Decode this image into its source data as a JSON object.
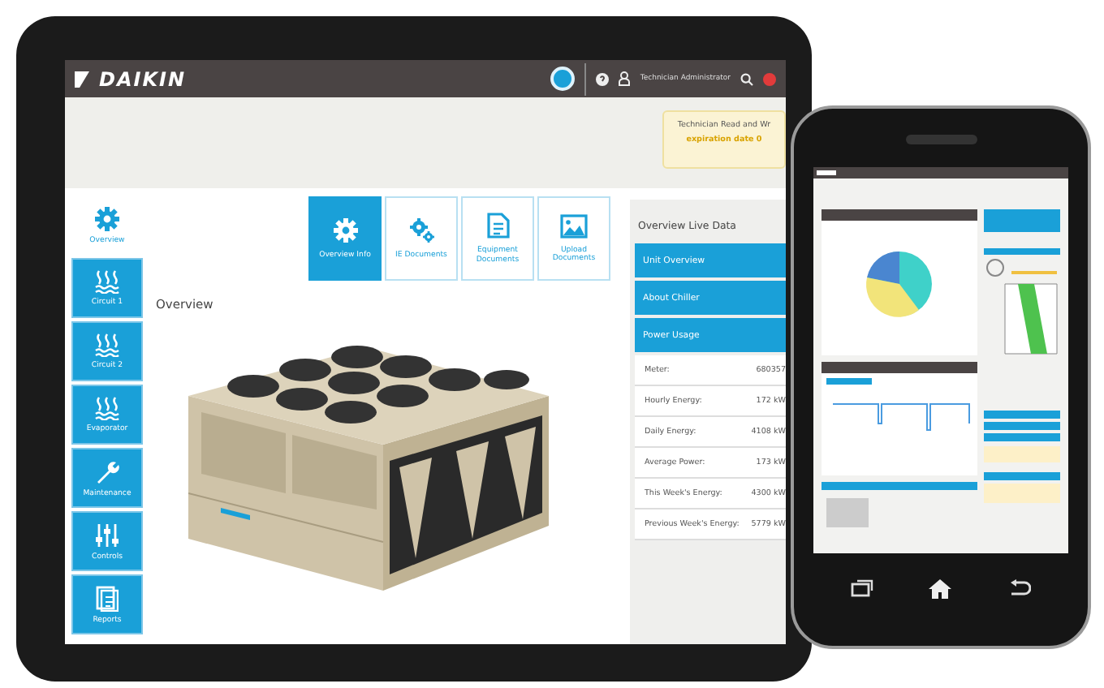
{
  "header": {
    "logo": "DAIKIN",
    "user": "Technician Administrator"
  },
  "banner": {
    "line1": "Technician Read and Wr",
    "line2": "expiration date 0"
  },
  "sidebar": {
    "items": [
      {
        "label": "Overview",
        "kind": "gear",
        "selected": true
      },
      {
        "label": "Circuit 1",
        "kind": "heat",
        "selected": false
      },
      {
        "label": "Circuit 2",
        "kind": "heat",
        "selected": false
      },
      {
        "label": "Evaporator",
        "kind": "heat",
        "selected": false
      },
      {
        "label": "Maintenance",
        "kind": "wrench",
        "selected": false
      },
      {
        "label": "Controls",
        "kind": "sliders",
        "selected": false
      },
      {
        "label": "Reports",
        "kind": "report",
        "selected": false
      }
    ]
  },
  "tabs": [
    {
      "label": "Overview Info",
      "kind": "gear",
      "selected": true
    },
    {
      "label": "IE Documents",
      "kind": "gears",
      "selected": false
    },
    {
      "label": "Equipment Documents",
      "kind": "doc",
      "selected": false
    },
    {
      "label": "Upload Documents",
      "kind": "image",
      "selected": false
    }
  ],
  "section_title": "Overview",
  "live_data": {
    "title": "Overview Live Data",
    "accordions": [
      "Unit Overview",
      "About Chiller",
      "Power Usage"
    ],
    "rows": [
      {
        "label": "Meter:",
        "value": "680357"
      },
      {
        "label": "Hourly Energy:",
        "value": "172 kW"
      },
      {
        "label": "Daily Energy:",
        "value": "4108 kW"
      },
      {
        "label": "Average Power:",
        "value": "173 kW"
      },
      {
        "label": "This Week's Energy:",
        "value": "4300 kW"
      },
      {
        "label": "Previous Week's Energy:",
        "value": "5779 kW"
      }
    ]
  }
}
